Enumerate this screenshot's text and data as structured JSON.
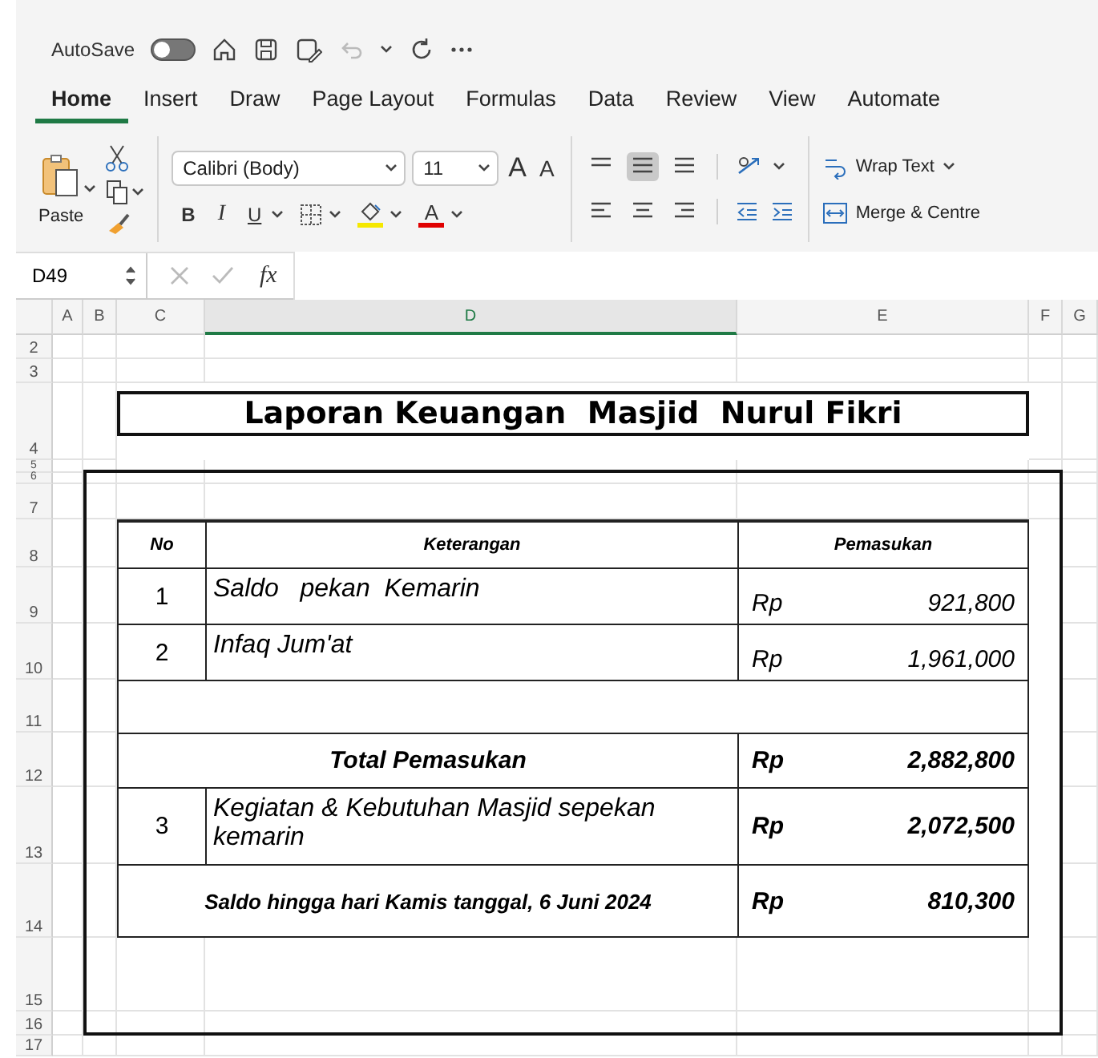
{
  "quick_access": {
    "autosave_label": "AutoSave",
    "autosave_on": false,
    "undo_disabled": true
  },
  "tabs": [
    {
      "label": "Home",
      "selected": true
    },
    {
      "label": "Insert",
      "selected": false
    },
    {
      "label": "Draw",
      "selected": false
    },
    {
      "label": "Page Layout",
      "selected": false
    },
    {
      "label": "Formulas",
      "selected": false
    },
    {
      "label": "Data",
      "selected": false
    },
    {
      "label": "Review",
      "selected": false
    },
    {
      "label": "View",
      "selected": false
    },
    {
      "label": "Automate",
      "selected": false
    }
  ],
  "ribbon": {
    "paste_label": "Paste",
    "font_name": "Calibri (Body)",
    "font_size": "11",
    "grow_font": "A",
    "shrink_font": "A",
    "bold": "B",
    "italic": "I",
    "underline": "U",
    "font_color": "A",
    "wrap_text": "Wrap Text",
    "merge": "Merge & Centre",
    "middle_align_selected": true
  },
  "formula_bar": {
    "cell_ref": "D49",
    "fx": "fx"
  },
  "sheet": {
    "columns": [
      {
        "label": "A",
        "selected": false
      },
      {
        "label": "B",
        "selected": false
      },
      {
        "label": "C",
        "selected": false
      },
      {
        "label": "D",
        "selected": true
      },
      {
        "label": "E",
        "selected": false
      },
      {
        "label": "F",
        "selected": false
      },
      {
        "label": "G",
        "selected": false
      }
    ],
    "rows": [
      "2",
      "3",
      "4",
      "5",
      "6",
      "7",
      "8",
      "9",
      "10",
      "11",
      "12",
      "13",
      "14",
      "15",
      "16",
      "17"
    ],
    "title": "Laporan Keuangan  Masjid  Nurul Fikri",
    "table": {
      "headers": [
        "No",
        "Keterangan",
        "Pemasukan"
      ],
      "rows": [
        {
          "kind": "item",
          "no": "1",
          "description": "Saldo   pekan  Kemarin",
          "currency": "Rp",
          "amount": "921,800",
          "emphasis": false
        },
        {
          "kind": "item",
          "no": "2",
          "description": "Infaq Jum'at",
          "currency": "Rp",
          "amount": "1,961,000",
          "emphasis": false
        },
        {
          "kind": "blank"
        },
        {
          "kind": "total",
          "label": "Total Pemasukan",
          "currency": "Rp",
          "amount": "2,882,800"
        },
        {
          "kind": "item",
          "no": "3",
          "description": "Kegiatan & Kebutuhan Masjid sepekan kemarin",
          "currency": "Rp",
          "amount": "2,072,500",
          "emphasis": true
        },
        {
          "kind": "summary",
          "label": "Saldo hingga hari Kamis tanggal, 6 Juni 2024",
          "currency": "Rp",
          "amount": "810,300"
        }
      ]
    }
  }
}
